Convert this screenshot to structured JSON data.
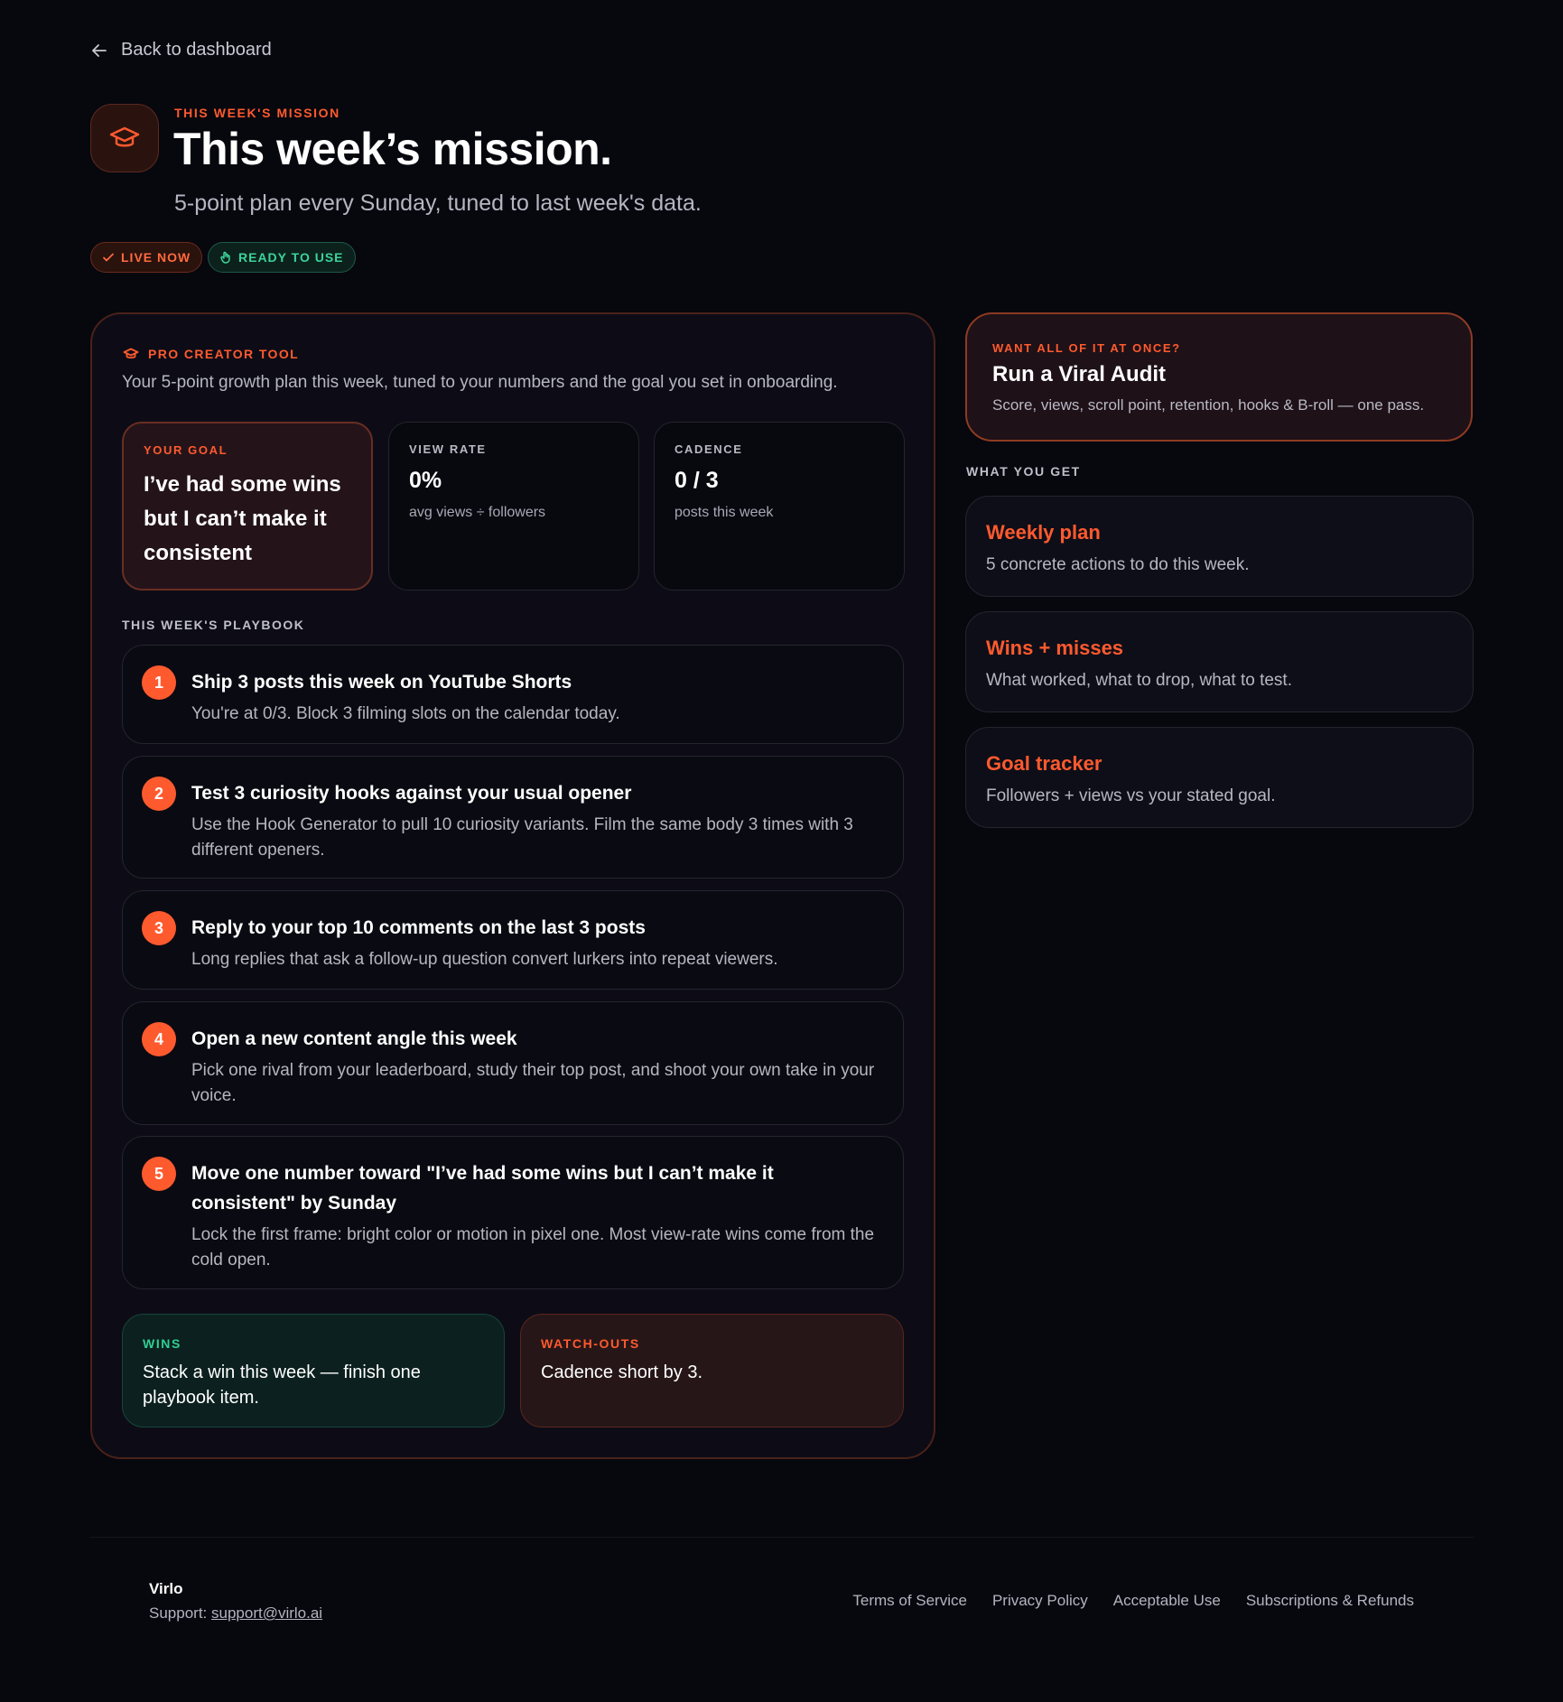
{
  "nav": {
    "back_label": "Back to dashboard"
  },
  "hero": {
    "eyebrow": "THIS WEEK'S MISSION",
    "title": "This week’s mission.",
    "subtitle": "5-point plan every Sunday, tuned to last week's data.",
    "badges": [
      {
        "label": "LIVE NOW",
        "icon": "check-icon",
        "color": "#ff6a3d"
      },
      {
        "label": "READY TO USE",
        "icon": "hand-icon",
        "color": "#3cd39a"
      }
    ],
    "icon": "graduation-cap-icon"
  },
  "tool": {
    "label": "PRO CREATOR TOOL",
    "description": "Your 5-point growth plan this week, tuned to your numbers and the goal you set in onboarding.",
    "goal": {
      "label": "YOUR GOAL",
      "text": "I’ve had some wins but I can’t make it consistent"
    },
    "view_rate": {
      "label": "VIEW RATE",
      "value": "0%",
      "caption": "avg views ÷ followers"
    },
    "cadence": {
      "label": "CADENCE",
      "value": "0 / 3",
      "caption": "posts this week"
    }
  },
  "playbook": {
    "label": "THIS WEEK'S PLAYBOOK",
    "items": [
      {
        "num": "1",
        "title": "Ship 3 posts this week on YouTube Shorts",
        "desc": "You're at 0/3. Block 3 filming slots on the calendar today."
      },
      {
        "num": "2",
        "title": "Test 3 curiosity hooks against your usual opener",
        "desc": "Use the Hook Generator to pull 10 curiosity variants. Film the same body 3 times with 3 different openers."
      },
      {
        "num": "3",
        "title": "Reply to your top 10 comments on the last 3 posts",
        "desc": "Long replies that ask a follow-up question convert lurkers into repeat viewers."
      },
      {
        "num": "4",
        "title": "Open a new content angle this week",
        "desc": "Pick one rival from your leaderboard, study their top post, and shoot your own take in your voice."
      },
      {
        "num": "5",
        "title": "Move one number toward \"I’ve had some wins but I can’t make it consistent\" by Sunday",
        "desc": "Lock the first frame: bright color or motion in pixel one. Most view-rate wins come from the cold open."
      }
    ]
  },
  "wins": {
    "label": "WINS",
    "text": "Stack a win this week — finish one playbook item."
  },
  "watchouts": {
    "label": "WATCH-OUTS",
    "text": "Cadence short by 3."
  },
  "audit": {
    "eyebrow": "WANT ALL OF IT AT ONCE?",
    "title": "Run a Viral Audit",
    "desc": "Score, views, scroll point, retention, hooks & B-roll — one pass."
  },
  "what_you_get": {
    "label": "WHAT YOU GET",
    "features": [
      {
        "title": "Weekly plan",
        "desc": "5 concrete actions to do this week."
      },
      {
        "title": "Wins + misses",
        "desc": "What worked, what to drop, what to test."
      },
      {
        "title": "Goal tracker",
        "desc": "Followers + views vs your stated goal."
      }
    ]
  },
  "footer": {
    "brand": "Virlo",
    "support_prefix": "Support:",
    "support_email": "support@virlo.ai",
    "links": [
      "Terms of Service",
      "Privacy Policy",
      "Acceptable Use",
      "Subscriptions & Refunds"
    ]
  },
  "colors": {
    "accent": "#ff5a2e",
    "success": "#2fcf93",
    "background": "#07070e"
  }
}
